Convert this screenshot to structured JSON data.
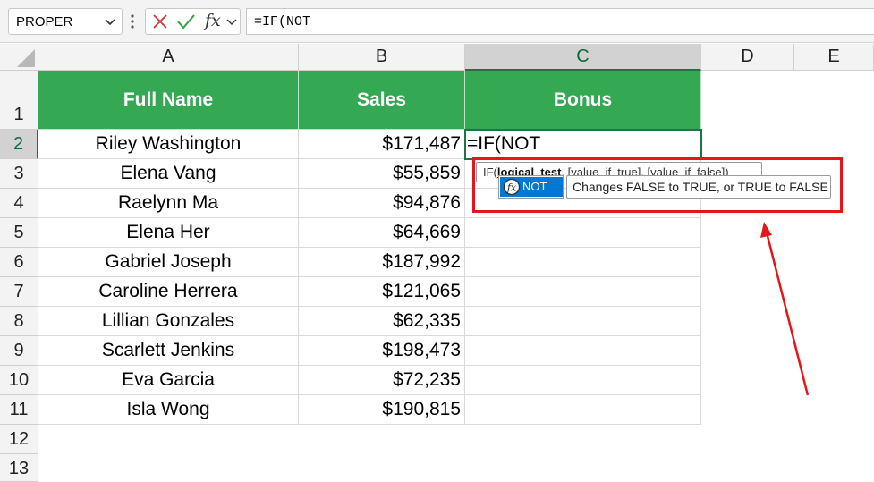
{
  "formula_bar": {
    "name_box": "PROPER",
    "fx_label": "fx",
    "formula": "=IF(NOT"
  },
  "columns": [
    "A",
    "B",
    "C",
    "D",
    "E"
  ],
  "rows": [
    "1",
    "2",
    "3",
    "4",
    "5",
    "6",
    "7",
    "8",
    "9",
    "10",
    "11",
    "12",
    "13"
  ],
  "table": {
    "headers": [
      "Full Name",
      "Sales",
      "Bonus"
    ],
    "rows": [
      {
        "name": "Riley Washington",
        "sales": "$171,487"
      },
      {
        "name": "Elena Vang",
        "sales": "$55,859"
      },
      {
        "name": "Raelynn Ma",
        "sales": "$94,876"
      },
      {
        "name": "Elena Her",
        "sales": "$64,669"
      },
      {
        "name": "Gabriel Joseph",
        "sales": "$187,992"
      },
      {
        "name": "Caroline Herrera",
        "sales": "$121,065"
      },
      {
        "name": "Lillian Gonzales",
        "sales": "$62,335"
      },
      {
        "name": "Scarlett Jenkins",
        "sales": "$198,473"
      },
      {
        "name": "Eva Garcia",
        "sales": "$72,235"
      },
      {
        "name": "Isla Wong",
        "sales": "$190,815"
      }
    ]
  },
  "active_cell": {
    "column": "C",
    "row": "2",
    "value": "=IF(NOT"
  },
  "autocomplete": {
    "syntax_prefix": "IF(",
    "syntax_bold": "logical_test",
    "syntax_rest": ", [value_if_true], [value_if_false])",
    "suggestion": "NOT",
    "suggestion_icon": "function-icon",
    "description": "Changes FALSE to TRUE, or TRUE to FALSE"
  },
  "annotation": {
    "color": "#e3161c"
  },
  "colors": {
    "header_fill": "#34a853",
    "selection": "#217346",
    "autocomplete_highlight": "#0078d4"
  }
}
